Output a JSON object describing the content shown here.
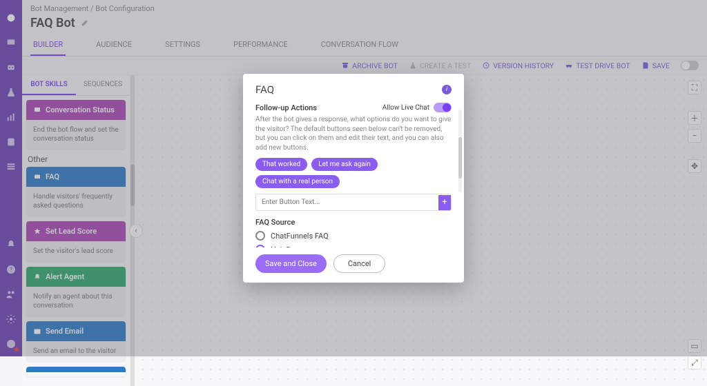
{
  "breadcrumb": {
    "parent": "Bot Management",
    "sep": "/",
    "current": "Bot Configuration"
  },
  "page_title": "FAQ Bot",
  "tabs": [
    "BUILDER",
    "AUDIENCE",
    "SETTINGS",
    "PERFORMANCE",
    "CONVERSATION FLOW"
  ],
  "active_tab": 0,
  "toolbar": {
    "archive": "ARCHIVE BOT",
    "create_test": "CREATE A TEST",
    "version": "VERSION HISTORY",
    "test_drive": "TEST DRIVE BOT",
    "save": "SAVE"
  },
  "subtabs": [
    "BOT SKILLS",
    "SEQUENCES"
  ],
  "active_subtab": 0,
  "skills": {
    "group_other": "Other",
    "items": [
      {
        "color": "c-purple",
        "title": "Conversation Status",
        "desc": "End the bot flow and set the conversation status"
      },
      {
        "color": "c-blue",
        "title": "FAQ",
        "desc": "Handle visitors' frequently asked questions"
      },
      {
        "color": "c-purple",
        "title": "Set Lead Score",
        "desc": "Set the visitor's lead score"
      },
      {
        "color": "c-green",
        "title": "Alert Agent",
        "desc": "Notify an agent about this conversation"
      },
      {
        "color": "c-blue",
        "title": "Send Email",
        "desc": "Send an email to the visitor"
      }
    ]
  },
  "modal": {
    "title": "FAQ",
    "section": "Follow-up Actions",
    "live_chat_label": "Allow Live Chat",
    "desc": "After the bot gives a response, what options do you want to give the visitor? The default buttons seen below can't be removed, but you can click on them and edit their text, and you can also add new buttons.",
    "chips": [
      "That worked",
      "Let me ask again",
      "Chat with a real person"
    ],
    "new_placeholder": "Enter Button Text...",
    "source_label": "FAQ Source",
    "sources": [
      "ChatFunnels FAQ",
      "HelpDocs"
    ],
    "selected_source": 1,
    "save": "Save and Close",
    "cancel": "Cancel"
  }
}
